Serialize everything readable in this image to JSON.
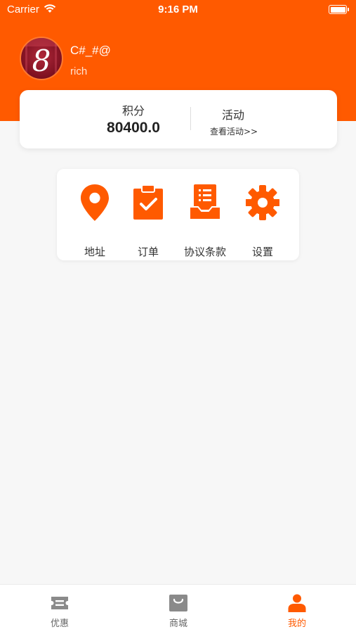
{
  "status_bar": {
    "carrier": "Carrier",
    "time": "9:16 PM"
  },
  "profile": {
    "avatar_text": "8",
    "name": "C#_#@",
    "level": "rich"
  },
  "points_card": {
    "points_label": "积分",
    "points_value": "80400.0",
    "activity_title": "活动",
    "activity_link": "查看活动>>"
  },
  "menu": {
    "items": [
      {
        "label": "地址",
        "icon": "location-pin-icon"
      },
      {
        "label": "订单",
        "icon": "clipboard-check-icon"
      },
      {
        "label": "协议条款",
        "icon": "document-tray-icon"
      },
      {
        "label": "设置",
        "icon": "gear-icon"
      }
    ]
  },
  "tab_bar": {
    "tabs": [
      {
        "label": "优惠",
        "icon": "ticket-icon",
        "active": false
      },
      {
        "label": "商城",
        "icon": "shopping-bag-icon",
        "active": false
      },
      {
        "label": "我的",
        "icon": "person-icon",
        "active": true
      }
    ]
  },
  "colors": {
    "accent": "#ff5a00",
    "background": "#f7f7f7",
    "inactive_icon": "#8a8a8a"
  }
}
